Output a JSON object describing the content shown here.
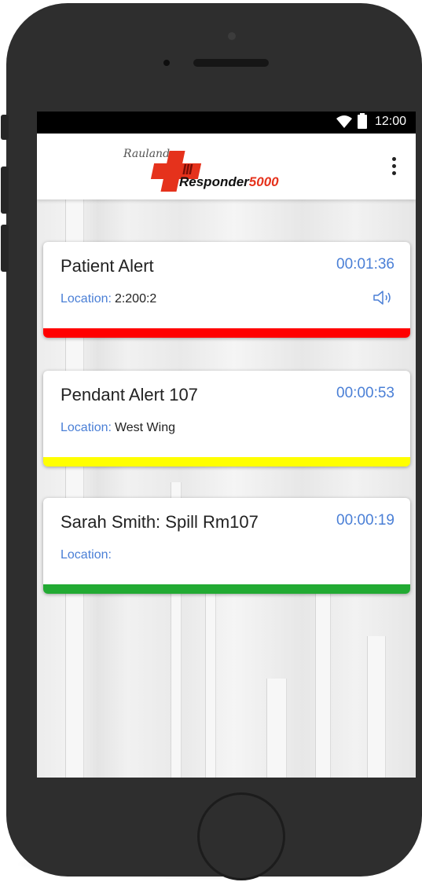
{
  "statusbar": {
    "time": "12:00"
  },
  "logo": {
    "rauland": "Rauland",
    "stripes": "III",
    "responder": "Responder",
    "model": "5000"
  },
  "alerts": [
    {
      "title": "Patient Alert",
      "timer": "00:01:36",
      "location_label": "Location:",
      "location_value": "2:200:2",
      "color": "#ff0000",
      "sound_icon": "speaker-icon"
    },
    {
      "title": "Pendant Alert 107",
      "timer": "00:00:53",
      "location_label": "Location:",
      "location_value": "West Wing",
      "color": "#ffff00"
    },
    {
      "title": "Sarah Smith: Spill Rm107",
      "timer": "00:00:19",
      "location_label": "Location:",
      "location_value": "",
      "color": "#22aa33"
    }
  ],
  "colors": {
    "accent": "#4a7fd6",
    "brand_red": "#e5321c",
    "phone": "#2e2e2e"
  }
}
